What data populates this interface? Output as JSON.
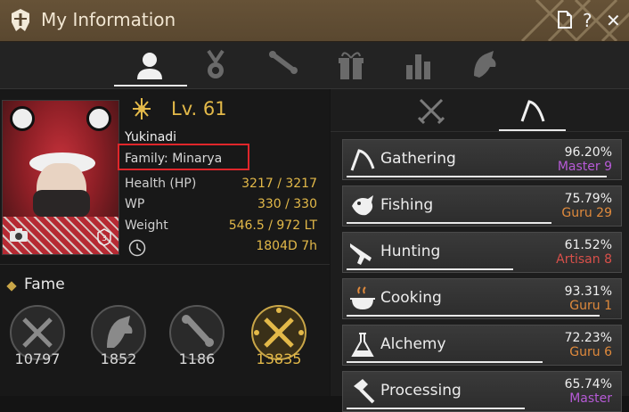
{
  "window": {
    "title": "My Information",
    "buttons": [
      "page-icon",
      "help-icon",
      "close-icon"
    ]
  },
  "tabs": [
    {
      "icon": "profile-icon",
      "active": true
    },
    {
      "icon": "medal-icon",
      "active": false
    },
    {
      "icon": "scroll-icon",
      "active": false
    },
    {
      "icon": "gift-icon",
      "active": false
    },
    {
      "icon": "stats-chart-icon",
      "active": false
    },
    {
      "icon": "horse-icon",
      "active": false
    }
  ],
  "character": {
    "level": "Lv. 61",
    "name": "Yukinadi",
    "family": "Family: Minarya",
    "stats": [
      {
        "label": "Health (HP)",
        "value": "3217 / 3217"
      },
      {
        "label": "WP",
        "value": "330 / 330"
      },
      {
        "label": "Weight",
        "value": "546.5 / 972 LT"
      }
    ],
    "playtime": "1804D 7h"
  },
  "fame": {
    "title": "Fame",
    "items": [
      {
        "icon": "crossed-swords-icon",
        "value": "10797",
        "active": false
      },
      {
        "icon": "horse-head-icon",
        "value": "1852",
        "active": false
      },
      {
        "icon": "scroll-icon",
        "value": "1186",
        "active": false
      },
      {
        "icon": "crossed-swords-gold-icon",
        "value": "13835",
        "active": true
      }
    ]
  },
  "right_tabs": [
    {
      "icon": "combat-swords-icon",
      "active": false
    },
    {
      "icon": "sickle-icon",
      "active": true
    }
  ],
  "skills": [
    {
      "name": "Gathering",
      "percent": "96.20%",
      "rank": "Master 9",
      "rank_color": "#b65ad6",
      "progress": 0.962,
      "icon": "sickle-icon"
    },
    {
      "name": "Fishing",
      "percent": "75.79%",
      "rank": "Guru 29",
      "rank_color": "#e08a3c",
      "progress": 0.7579,
      "icon": "fish-icon"
    },
    {
      "name": "Hunting",
      "percent": "61.52%",
      "rank": "Artisan 8",
      "rank_color": "#d8504a",
      "progress": 0.6152,
      "icon": "rifle-icon"
    },
    {
      "name": "Cooking",
      "percent": "93.31%",
      "rank": "Guru 1",
      "rank_color": "#e08a3c",
      "progress": 0.9331,
      "icon": "cooking-pot-icon"
    },
    {
      "name": "Alchemy",
      "percent": "72.23%",
      "rank": "Guru 6",
      "rank_color": "#e08a3c",
      "progress": 0.7223,
      "icon": "flask-icon"
    },
    {
      "name": "Processing",
      "percent": "65.74%",
      "rank": "Master",
      "rank_color": "#b65ad6",
      "progress": 0.6574,
      "icon": "hammer-icon"
    }
  ]
}
